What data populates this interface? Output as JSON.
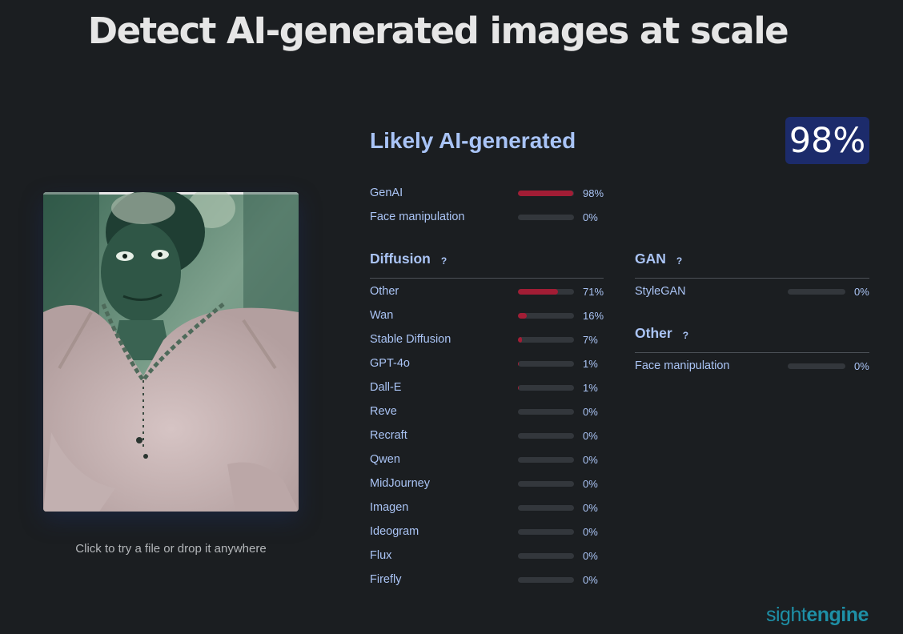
{
  "page": {
    "title": "Detect AI-generated images at scale"
  },
  "upload": {
    "hint": "Click to try a file or drop it anywhere"
  },
  "result": {
    "verdict": "Likely AI-generated",
    "score": "98%",
    "summary": [
      {
        "label": "GenAI",
        "value": 98,
        "display": "98%"
      },
      {
        "label": "Face manipulation",
        "value": 0,
        "display": "0%"
      }
    ]
  },
  "sections": {
    "diffusion": {
      "title": "Diffusion",
      "help": "?",
      "items": [
        {
          "label": "Other",
          "value": 71,
          "display": "71%"
        },
        {
          "label": "Wan",
          "value": 16,
          "display": "16%"
        },
        {
          "label": "Stable Diffusion",
          "value": 7,
          "display": "7%"
        },
        {
          "label": "GPT-4o",
          "value": 1,
          "display": "1%"
        },
        {
          "label": "Dall-E",
          "value": 1,
          "display": "1%"
        },
        {
          "label": "Reve",
          "value": 0,
          "display": "0%"
        },
        {
          "label": "Recraft",
          "value": 0,
          "display": "0%"
        },
        {
          "label": "Qwen",
          "value": 0,
          "display": "0%"
        },
        {
          "label": "MidJourney",
          "value": 0,
          "display": "0%"
        },
        {
          "label": "Imagen",
          "value": 0,
          "display": "0%"
        },
        {
          "label": "Ideogram",
          "value": 0,
          "display": "0%"
        },
        {
          "label": "Flux",
          "value": 0,
          "display": "0%"
        },
        {
          "label": "Firefly",
          "value": 0,
          "display": "0%"
        }
      ]
    },
    "gan": {
      "title": "GAN",
      "help": "?",
      "items": [
        {
          "label": "StyleGAN",
          "value": 0,
          "display": "0%"
        }
      ]
    },
    "other": {
      "title": "Other",
      "help": "?",
      "items": [
        {
          "label": "Face manipulation",
          "value": 0,
          "display": "0%"
        }
      ]
    }
  },
  "brand": {
    "part1": "sight",
    "part2": "engine"
  },
  "colors": {
    "background": "#1b1e21",
    "accent_text": "#aac4f5",
    "bar_fill": "#a21d35",
    "bar_track": "#33373c",
    "badge": "#1c2b6b",
    "brand": "#1e8fa6"
  }
}
